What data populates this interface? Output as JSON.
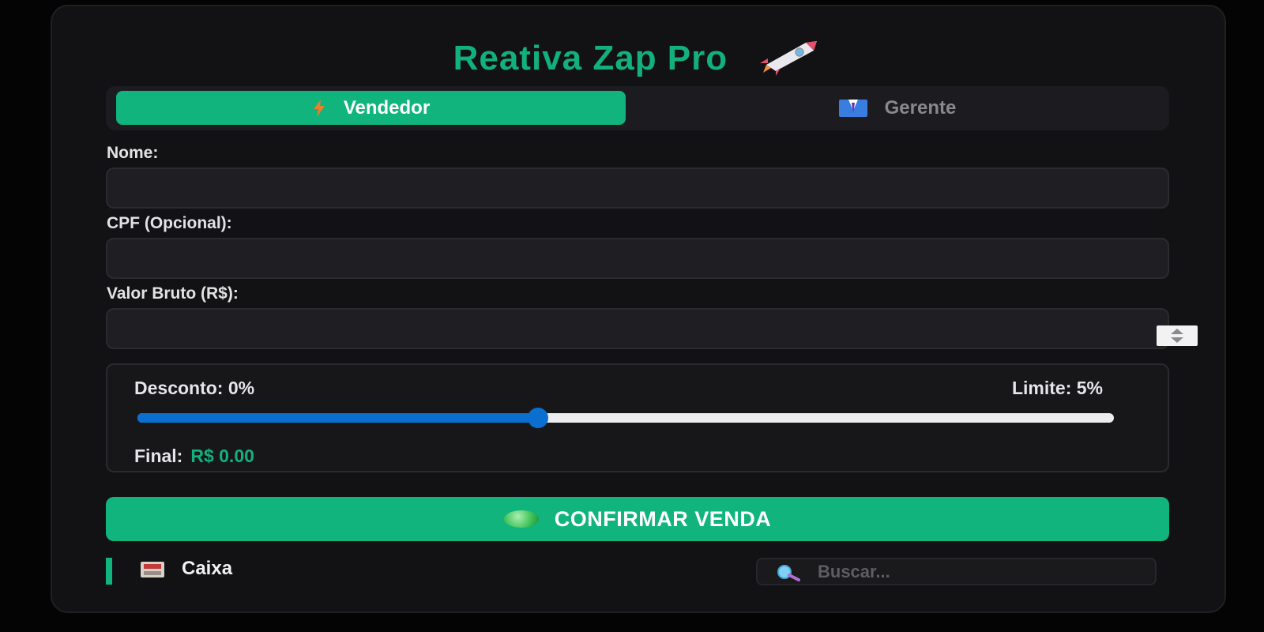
{
  "app": {
    "title": "Reativa Zap Pro",
    "title_icon": "rocket-icon"
  },
  "tabs": [
    {
      "label": "Vendedor",
      "icon": "lightning-icon",
      "active": true
    },
    {
      "label": "Gerente",
      "icon": "suit-icon",
      "active": false
    }
  ],
  "form": {
    "nome": {
      "label": "Nome:",
      "value": "",
      "placeholder": ""
    },
    "cpf": {
      "label": "CPF (Opcional):",
      "value": "",
      "placeholder": ""
    },
    "valor_bruto": {
      "label": "Valor Bruto (R$):",
      "value": "",
      "placeholder": ""
    }
  },
  "discount": {
    "label": "Desconto: 0%",
    "limit_label": "Limite: 5%",
    "slider_fraction": 0.41,
    "final_label": "Final:",
    "final_value": "R$ 0.00"
  },
  "confirm_button": {
    "label": "CONFIRMAR VENDA",
    "icon": "green-circle-icon"
  },
  "footer": {
    "caixa_label": "Caixa",
    "caixa_icon": "register-icon",
    "search_placeholder": "Buscar...",
    "search_value": ""
  },
  "colors": {
    "accent": "#11b47c",
    "slider": "#0a6fd0",
    "background": "#040404",
    "card": "#121215"
  }
}
